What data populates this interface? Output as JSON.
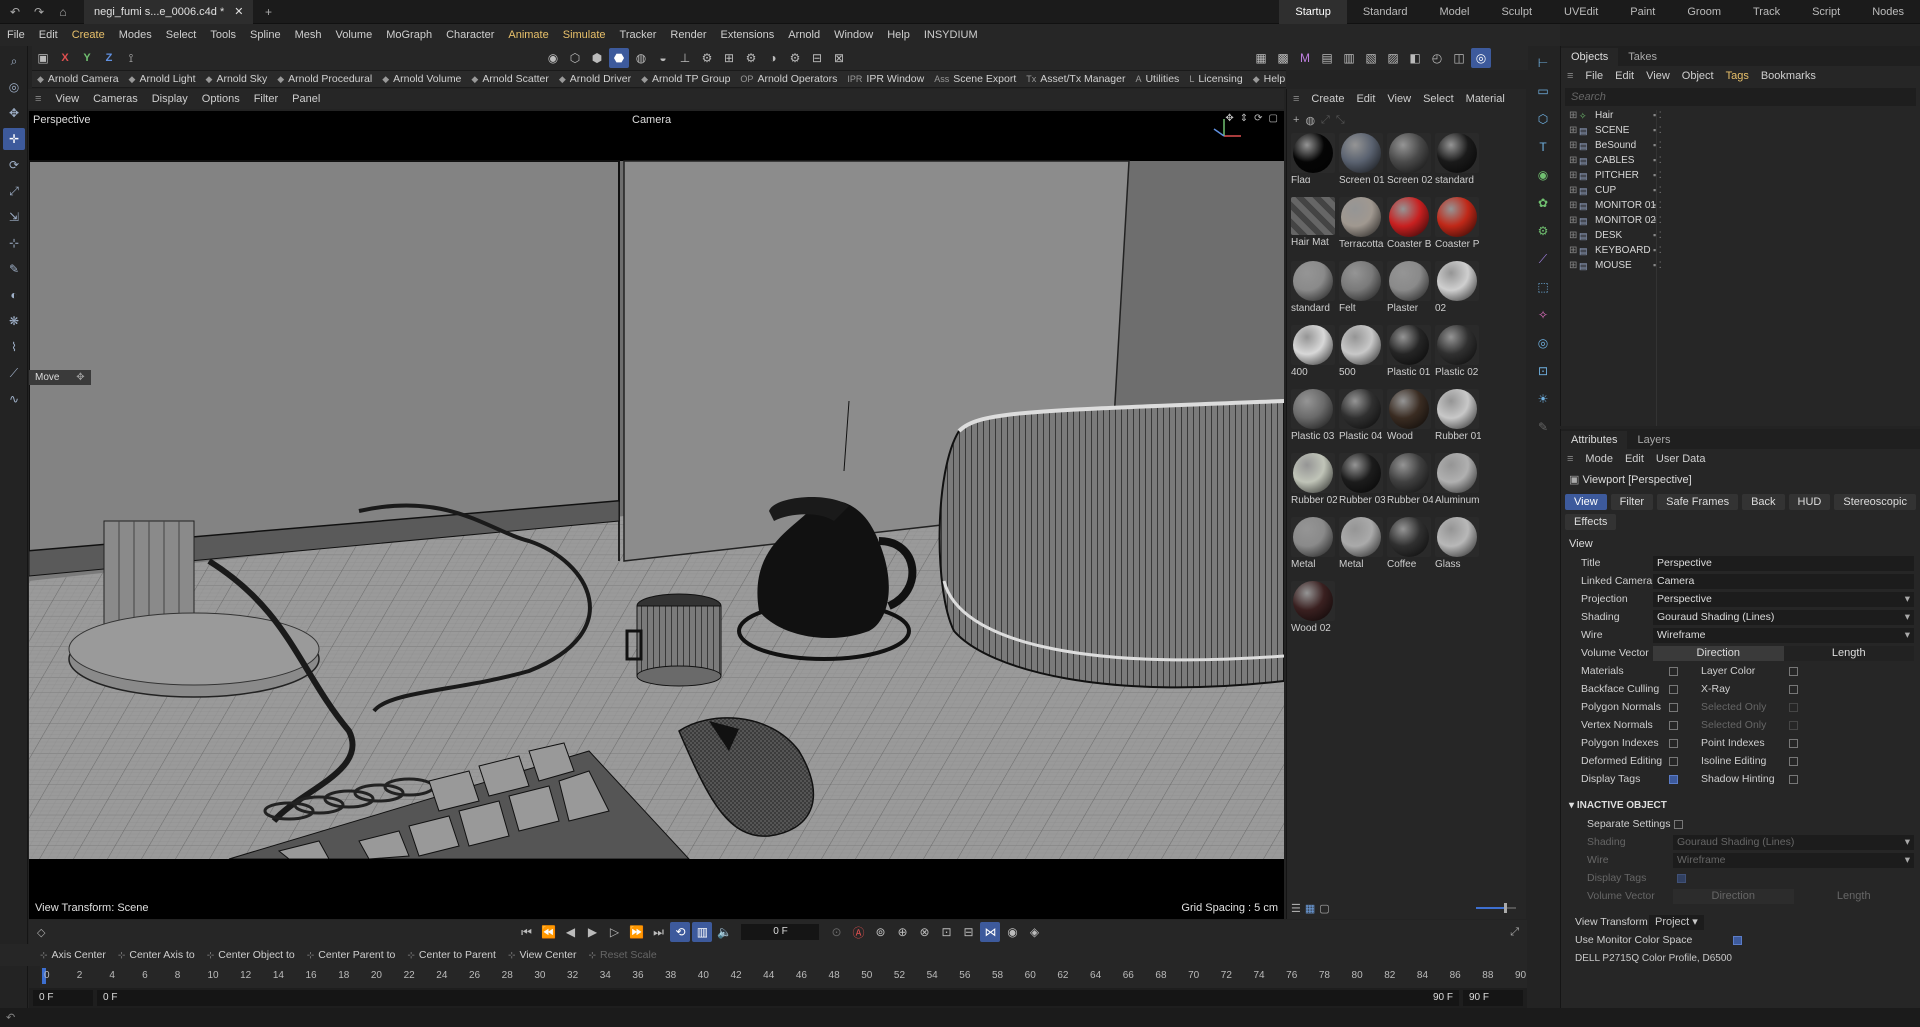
{
  "titlebar": {
    "doc_title": "negi_fumi s...e_0006.c4d *",
    "layouts": [
      "Startup",
      "Standard",
      "Model",
      "Sculpt",
      "UVEdit",
      "Paint",
      "Groom",
      "Track",
      "Script",
      "Nodes"
    ]
  },
  "menubar": [
    "File",
    "Edit",
    "Create",
    "Modes",
    "Select",
    "Tools",
    "Spline",
    "Mesh",
    "Volume",
    "MoGraph",
    "Character",
    "Animate",
    "Simulate",
    "Tracker",
    "Render",
    "Extensions",
    "Arnold",
    "Window",
    "Help",
    "INSYDIUM"
  ],
  "arnoldbar": [
    "Arnold Camera",
    "Arnold Light",
    "Arnold Sky",
    "Arnold Procedural",
    "Arnold Volume",
    "Arnold Scatter",
    "Arnold Driver",
    "Arnold TP Group",
    "Arnold Operators",
    "IPR Window",
    "Scene Export",
    "Asset/Tx Manager",
    "Utilities",
    "Licensing",
    "Help"
  ],
  "arnold_prefix": {
    "op": "OP",
    "ipr": "IPR",
    "ass": "Ass",
    "tx": "Tx",
    "a": "A",
    "l": "L"
  },
  "toolbar_axis": {
    "x": "X",
    "y": "Y",
    "z": "Z"
  },
  "viewport_menu": [
    "View",
    "Cameras",
    "Display",
    "Options",
    "Filter",
    "Panel"
  ],
  "viewport": {
    "label": "Perspective",
    "camera": "Camera",
    "view_transform": "View Transform: Scene",
    "grid_spacing": "Grid Spacing : 5 cm",
    "move_tag": "Move"
  },
  "material_menu": [
    "Create",
    "Edit",
    "View",
    "Select",
    "Material"
  ],
  "materials": [
    {
      "name": "Flag",
      "color": "#050505"
    },
    {
      "name": "Screen 01",
      "color": "#5a6270"
    },
    {
      "name": "Screen 02",
      "color": "#4a4a4a"
    },
    {
      "name": "standard_",
      "color": "#1a1a1a"
    },
    {
      "name": "Hair Mat",
      "color": "#555555"
    },
    {
      "name": "Terracotta",
      "color": "#a09890"
    },
    {
      "name": "Coaster B",
      "color": "#c82020"
    },
    {
      "name": "Coaster P",
      "color": "#c02818"
    },
    {
      "name": "standard_",
      "color": "#8a8a8a"
    },
    {
      "name": "Felt",
      "color": "#7a7a7a"
    },
    {
      "name": "Plaster",
      "color": "#8a8a8a"
    },
    {
      "name": "02",
      "color": "#cfcfcf"
    },
    {
      "name": "400",
      "color": "#d8d8d8"
    },
    {
      "name": "500",
      "color": "#c8c8c8"
    },
    {
      "name": "Plastic 01",
      "color": "#252525"
    },
    {
      "name": "Plastic 02",
      "color": "#303030"
    },
    {
      "name": "Plastic 03",
      "color": "#6a6a6a"
    },
    {
      "name": "Plastic 04",
      "color": "#303030"
    },
    {
      "name": "Wood",
      "color": "#3a2c22"
    },
    {
      "name": "Rubber 01",
      "color": "#c8c8c8"
    },
    {
      "name": "Rubber 02",
      "color": "#c0c4b8"
    },
    {
      "name": "Rubber 03",
      "color": "#1c1c1c"
    },
    {
      "name": "Rubber 04",
      "color": "#404040"
    },
    {
      "name": "Aluminum",
      "color": "#b0b0b0"
    },
    {
      "name": "Metal",
      "color": "#8a8a8a"
    },
    {
      "name": "Metal",
      "color": "#aaaaaa"
    },
    {
      "name": "Coffee",
      "color": "#303030"
    },
    {
      "name": "Glass",
      "color": "#b8b8b8"
    },
    {
      "name": "Wood 02",
      "color": "#3a2020"
    }
  ],
  "objects_panel": {
    "tabs": [
      "Objects",
      "Takes"
    ],
    "menu": [
      "File",
      "Edit",
      "View",
      "Object",
      "Tags",
      "Bookmarks"
    ],
    "search_placeholder": "Search",
    "items": [
      "Hair",
      "SCENE",
      "BeSound",
      "CABLES",
      "PITCHER",
      "CUP",
      "MONITOR 01",
      "MONITOR 02",
      "DESK",
      "KEYBOARD",
      "MOUSE"
    ]
  },
  "attributes": {
    "tabs": [
      "Attributes",
      "Layers"
    ],
    "menu": [
      "Mode",
      "Edit",
      "User Data"
    ],
    "header": "Viewport [Perspective]",
    "buttons": [
      "View",
      "Filter",
      "Safe Frames",
      "Back",
      "HUD",
      "Stereoscopic",
      "Effects"
    ],
    "section": "View",
    "title_label": "Title",
    "title_value": "Perspective",
    "linked_camera_label": "Linked Camera",
    "linked_camera_value": "Camera",
    "projection_label": "Projection",
    "projection_value": "Perspective",
    "shading_label": "Shading",
    "shading_value": "Gouraud Shading (Lines)",
    "wire_label": "Wire",
    "wire_value": "Wireframe",
    "volume_vector_label": "Volume Vector",
    "direction": "Direction",
    "length": "Length",
    "checks_left": [
      {
        "l": "Materials",
        "on": false
      },
      {
        "l": "Backface Culling",
        "on": false
      },
      {
        "l": "Polygon Normals",
        "on": false
      },
      {
        "l": "Vertex Normals",
        "on": false
      },
      {
        "l": "Polygon Indexes",
        "on": false
      },
      {
        "l": "Deformed Editing",
        "on": false
      },
      {
        "l": "Display Tags",
        "on": true
      }
    ],
    "checks_right": [
      {
        "l": "Layer Color",
        "on": false
      },
      {
        "l": "X-Ray",
        "on": false
      },
      {
        "l": "Selected Only",
        "on": false
      },
      {
        "l": "Selected Only",
        "on": false
      },
      {
        "l": "Point Indexes",
        "on": false
      },
      {
        "l": "Isoline Editing",
        "on": false
      },
      {
        "l": "Shadow Hinting",
        "on": false
      }
    ],
    "inactive_section": "INACTIVE OBJECT",
    "separate_settings": "Separate Settings",
    "in_shading_label": "Shading",
    "in_shading_value": "Gouraud Shading (Lines)",
    "in_wire_label": "Wire",
    "in_wire_value": "Wireframe",
    "in_display_tags": "Display Tags",
    "in_volume_vector": "Volume Vector",
    "view_transform_label": "View Transform",
    "view_transform_value": "Project",
    "monitor_color": "Use Monitor Color Space",
    "color_profile": "DELL P2715Q Color Profile, D6500"
  },
  "timeline": {
    "current_frame": "0 F",
    "snap_buttons": [
      "Axis Center",
      "Center Axis to",
      "Center Object to",
      "Center Parent to",
      "Center to Parent",
      "View Center",
      "Reset Scale"
    ],
    "ruler": [
      "0",
      "2",
      "4",
      "6",
      "8",
      "10",
      "12",
      "14",
      "16",
      "18",
      "20",
      "22",
      "24",
      "26",
      "28",
      "30",
      "32",
      "34",
      "36",
      "38",
      "40",
      "42",
      "44",
      "46",
      "48",
      "50",
      "52",
      "54",
      "56",
      "58",
      "60",
      "62",
      "64",
      "66",
      "68",
      "70",
      "72",
      "74",
      "76",
      "78",
      "80",
      "82",
      "84",
      "86",
      "88",
      "90"
    ],
    "start": "0 F",
    "start2": "0 F",
    "end": "90 F",
    "end2": "90 F"
  }
}
